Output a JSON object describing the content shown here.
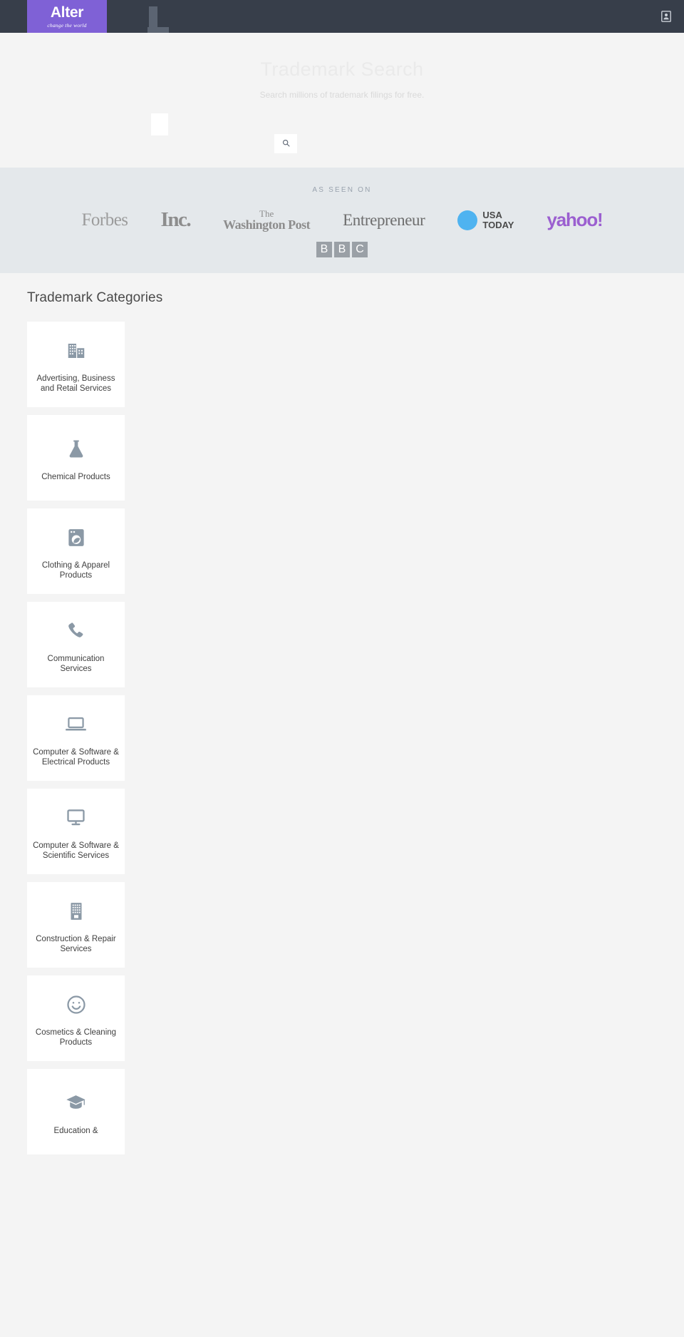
{
  "header": {
    "brand_word": "Alter",
    "brand_tagline": "change the world",
    "search_icon": "search-icon",
    "account_icon": "account-icon"
  },
  "hero": {
    "title": "Trademark Search",
    "subtitle": "Search millions of trademark filings for free.",
    "search_button_icon": "search-icon",
    "search_input_value": ""
  },
  "press": {
    "label": "AS SEEN ON",
    "logos": [
      {
        "name": "Forbes",
        "type": "forbes"
      },
      {
        "name": "Inc.",
        "type": "inc"
      },
      {
        "name": "The Washington Post",
        "the": "The",
        "title": "Washington Post",
        "type": "wapo"
      },
      {
        "name": "Entrepreneur",
        "type": "entrepreneur"
      },
      {
        "name": "USA TODAY",
        "line1": "USA",
        "line2": "TODAY",
        "type": "usatoday"
      },
      {
        "name": "yahoo!",
        "type": "yahoo"
      },
      {
        "name": "BBC",
        "letters": [
          "B",
          "B",
          "C"
        ],
        "type": "bbc"
      }
    ]
  },
  "categories": {
    "heading": "Trademark Categories",
    "items": [
      {
        "label": "Advertising, Business and Retail Services",
        "icon": "office-building-icon"
      },
      {
        "label": "Chemical Products",
        "icon": "flask-icon"
      },
      {
        "label": "Clothing & Apparel Products",
        "icon": "washing-machine-icon"
      },
      {
        "label": "Communication Services",
        "icon": "phone-icon"
      },
      {
        "label": "Computer & Software & Electrical Products",
        "icon": "laptop-icon"
      },
      {
        "label": "Computer & Software & Scientific Services",
        "icon": "desktop-monitor-icon"
      },
      {
        "label": "Construction & Repair Services",
        "icon": "building-icon"
      },
      {
        "label": "Cosmetics & Cleaning Products",
        "icon": "smiley-face-icon"
      },
      {
        "label": "Education &",
        "icon": "graduation-cap-icon"
      }
    ]
  },
  "colors": {
    "brand_purple": "#7f61d6",
    "navbar_dark": "#373e4a",
    "press_bg": "#e4e8eb",
    "page_bg": "#f4f4f4",
    "icon_gray": "#8b99a6"
  }
}
